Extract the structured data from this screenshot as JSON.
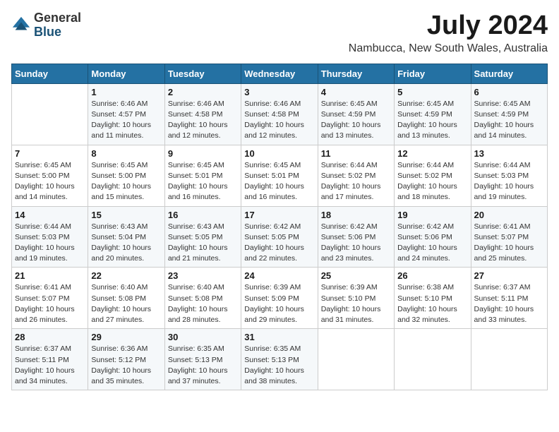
{
  "logo": {
    "general": "General",
    "blue": "Blue"
  },
  "title": {
    "month": "July 2024",
    "location": "Nambucca, New South Wales, Australia"
  },
  "headers": [
    "Sunday",
    "Monday",
    "Tuesday",
    "Wednesday",
    "Thursday",
    "Friday",
    "Saturday"
  ],
  "weeks": [
    [
      {
        "day": "",
        "sunrise": "",
        "sunset": "",
        "daylight": ""
      },
      {
        "day": "1",
        "sunrise": "Sunrise: 6:46 AM",
        "sunset": "Sunset: 4:57 PM",
        "daylight": "Daylight: 10 hours and 11 minutes."
      },
      {
        "day": "2",
        "sunrise": "Sunrise: 6:46 AM",
        "sunset": "Sunset: 4:58 PM",
        "daylight": "Daylight: 10 hours and 12 minutes."
      },
      {
        "day": "3",
        "sunrise": "Sunrise: 6:46 AM",
        "sunset": "Sunset: 4:58 PM",
        "daylight": "Daylight: 10 hours and 12 minutes."
      },
      {
        "day": "4",
        "sunrise": "Sunrise: 6:45 AM",
        "sunset": "Sunset: 4:59 PM",
        "daylight": "Daylight: 10 hours and 13 minutes."
      },
      {
        "day": "5",
        "sunrise": "Sunrise: 6:45 AM",
        "sunset": "Sunset: 4:59 PM",
        "daylight": "Daylight: 10 hours and 13 minutes."
      },
      {
        "day": "6",
        "sunrise": "Sunrise: 6:45 AM",
        "sunset": "Sunset: 4:59 PM",
        "daylight": "Daylight: 10 hours and 14 minutes."
      }
    ],
    [
      {
        "day": "7",
        "sunrise": "Sunrise: 6:45 AM",
        "sunset": "Sunset: 5:00 PM",
        "daylight": "Daylight: 10 hours and 14 minutes."
      },
      {
        "day": "8",
        "sunrise": "Sunrise: 6:45 AM",
        "sunset": "Sunset: 5:00 PM",
        "daylight": "Daylight: 10 hours and 15 minutes."
      },
      {
        "day": "9",
        "sunrise": "Sunrise: 6:45 AM",
        "sunset": "Sunset: 5:01 PM",
        "daylight": "Daylight: 10 hours and 16 minutes."
      },
      {
        "day": "10",
        "sunrise": "Sunrise: 6:45 AM",
        "sunset": "Sunset: 5:01 PM",
        "daylight": "Daylight: 10 hours and 16 minutes."
      },
      {
        "day": "11",
        "sunrise": "Sunrise: 6:44 AM",
        "sunset": "Sunset: 5:02 PM",
        "daylight": "Daylight: 10 hours and 17 minutes."
      },
      {
        "day": "12",
        "sunrise": "Sunrise: 6:44 AM",
        "sunset": "Sunset: 5:02 PM",
        "daylight": "Daylight: 10 hours and 18 minutes."
      },
      {
        "day": "13",
        "sunrise": "Sunrise: 6:44 AM",
        "sunset": "Sunset: 5:03 PM",
        "daylight": "Daylight: 10 hours and 19 minutes."
      }
    ],
    [
      {
        "day": "14",
        "sunrise": "Sunrise: 6:44 AM",
        "sunset": "Sunset: 5:03 PM",
        "daylight": "Daylight: 10 hours and 19 minutes."
      },
      {
        "day": "15",
        "sunrise": "Sunrise: 6:43 AM",
        "sunset": "Sunset: 5:04 PM",
        "daylight": "Daylight: 10 hours and 20 minutes."
      },
      {
        "day": "16",
        "sunrise": "Sunrise: 6:43 AM",
        "sunset": "Sunset: 5:05 PM",
        "daylight": "Daylight: 10 hours and 21 minutes."
      },
      {
        "day": "17",
        "sunrise": "Sunrise: 6:42 AM",
        "sunset": "Sunset: 5:05 PM",
        "daylight": "Daylight: 10 hours and 22 minutes."
      },
      {
        "day": "18",
        "sunrise": "Sunrise: 6:42 AM",
        "sunset": "Sunset: 5:06 PM",
        "daylight": "Daylight: 10 hours and 23 minutes."
      },
      {
        "day": "19",
        "sunrise": "Sunrise: 6:42 AM",
        "sunset": "Sunset: 5:06 PM",
        "daylight": "Daylight: 10 hours and 24 minutes."
      },
      {
        "day": "20",
        "sunrise": "Sunrise: 6:41 AM",
        "sunset": "Sunset: 5:07 PM",
        "daylight": "Daylight: 10 hours and 25 minutes."
      }
    ],
    [
      {
        "day": "21",
        "sunrise": "Sunrise: 6:41 AM",
        "sunset": "Sunset: 5:07 PM",
        "daylight": "Daylight: 10 hours and 26 minutes."
      },
      {
        "day": "22",
        "sunrise": "Sunrise: 6:40 AM",
        "sunset": "Sunset: 5:08 PM",
        "daylight": "Daylight: 10 hours and 27 minutes."
      },
      {
        "day": "23",
        "sunrise": "Sunrise: 6:40 AM",
        "sunset": "Sunset: 5:08 PM",
        "daylight": "Daylight: 10 hours and 28 minutes."
      },
      {
        "day": "24",
        "sunrise": "Sunrise: 6:39 AM",
        "sunset": "Sunset: 5:09 PM",
        "daylight": "Daylight: 10 hours and 29 minutes."
      },
      {
        "day": "25",
        "sunrise": "Sunrise: 6:39 AM",
        "sunset": "Sunset: 5:10 PM",
        "daylight": "Daylight: 10 hours and 31 minutes."
      },
      {
        "day": "26",
        "sunrise": "Sunrise: 6:38 AM",
        "sunset": "Sunset: 5:10 PM",
        "daylight": "Daylight: 10 hours and 32 minutes."
      },
      {
        "day": "27",
        "sunrise": "Sunrise: 6:37 AM",
        "sunset": "Sunset: 5:11 PM",
        "daylight": "Daylight: 10 hours and 33 minutes."
      }
    ],
    [
      {
        "day": "28",
        "sunrise": "Sunrise: 6:37 AM",
        "sunset": "Sunset: 5:11 PM",
        "daylight": "Daylight: 10 hours and 34 minutes."
      },
      {
        "day": "29",
        "sunrise": "Sunrise: 6:36 AM",
        "sunset": "Sunset: 5:12 PM",
        "daylight": "Daylight: 10 hours and 35 minutes."
      },
      {
        "day": "30",
        "sunrise": "Sunrise: 6:35 AM",
        "sunset": "Sunset: 5:13 PM",
        "daylight": "Daylight: 10 hours and 37 minutes."
      },
      {
        "day": "31",
        "sunrise": "Sunrise: 6:35 AM",
        "sunset": "Sunset: 5:13 PM",
        "daylight": "Daylight: 10 hours and 38 minutes."
      },
      {
        "day": "",
        "sunrise": "",
        "sunset": "",
        "daylight": ""
      },
      {
        "day": "",
        "sunrise": "",
        "sunset": "",
        "daylight": ""
      },
      {
        "day": "",
        "sunrise": "",
        "sunset": "",
        "daylight": ""
      }
    ]
  ]
}
